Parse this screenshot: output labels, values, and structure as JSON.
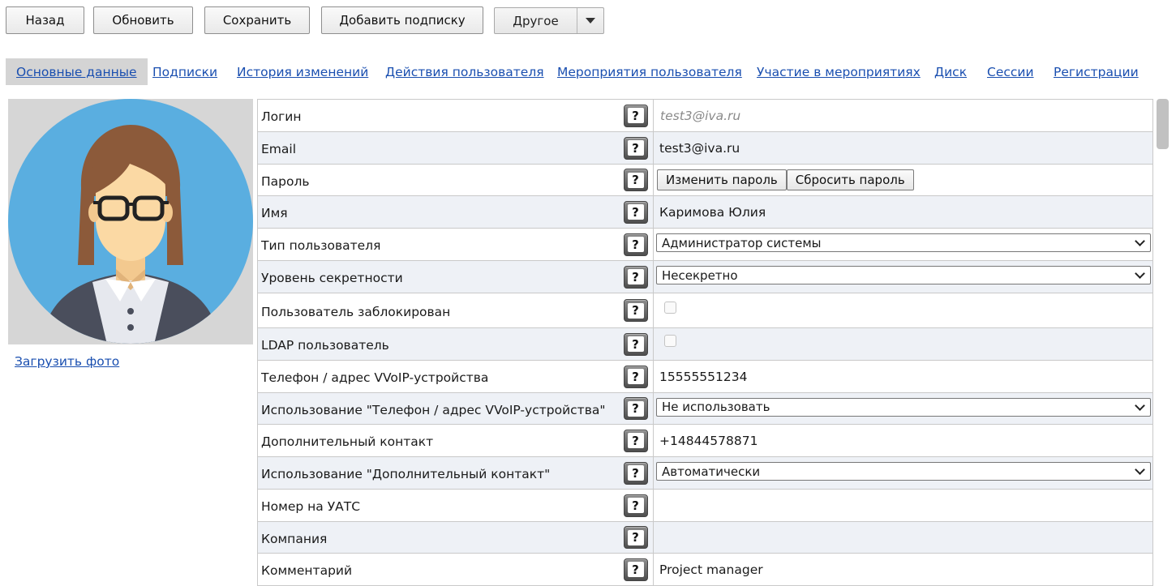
{
  "toolbar": {
    "back": "Назад",
    "refresh": "Обновить",
    "save": "Сохранить",
    "add_subscription": "Добавить подписку",
    "other": "Другое"
  },
  "tabs": [
    {
      "label": "Основные данные",
      "active": true
    },
    {
      "label": "Подписки",
      "active": false
    },
    {
      "label": "История изменений",
      "active": false
    },
    {
      "label": "Действия пользователя",
      "active": false
    },
    {
      "label": "Мероприятия пользователя",
      "active": false
    },
    {
      "label": "Участие в мероприятиях",
      "active": false
    },
    {
      "label": "Диск",
      "active": false
    },
    {
      "label": "Сессии",
      "active": false
    },
    {
      "label": "Регистрации",
      "active": false
    }
  ],
  "photo": {
    "upload_label": "Загрузить фото"
  },
  "help_glyph": "?",
  "fields": {
    "login": {
      "label": "Логин",
      "placeholder": "test3@iva.ru"
    },
    "email": {
      "label": "Email",
      "value": "test3@iva.ru"
    },
    "password": {
      "label": "Пароль",
      "change": "Изменить пароль",
      "reset": "Сбросить пароль"
    },
    "name": {
      "label": "Имя",
      "value": "Каримова Юлия"
    },
    "user_type": {
      "label": "Тип пользователя",
      "value": "Администратор системы"
    },
    "secrecy": {
      "label": "Уровень секретности",
      "value": "Несекретно"
    },
    "blocked": {
      "label": "Пользователь заблокирован",
      "checked": false
    },
    "ldap": {
      "label": "LDAP пользователь",
      "checked": false
    },
    "phone": {
      "label": "Телефон / адрес VVoIP-устройства",
      "value": "15555551234"
    },
    "phone_usage": {
      "label": "Использование \"Телефон / адрес VVoIP-устройства\"",
      "value": "Не использовать"
    },
    "extra_contact": {
      "label": "Дополнительный контакт",
      "value": "+14844578871"
    },
    "extra_usage": {
      "label": "Использование \"Дополнительный контакт\"",
      "value": "Автоматически"
    },
    "pbx_number": {
      "label": "Номер на УАТС",
      "value": ""
    },
    "company": {
      "label": "Компания",
      "value": ""
    },
    "comment": {
      "label": "Комментарий",
      "value": "Project manager"
    }
  },
  "colors": {
    "link": "#1a4fb0",
    "active_tab_bg": "#d4d4d4",
    "alt_row_bg": "#eef1f6",
    "avatar_circle": "#5aaee0"
  }
}
